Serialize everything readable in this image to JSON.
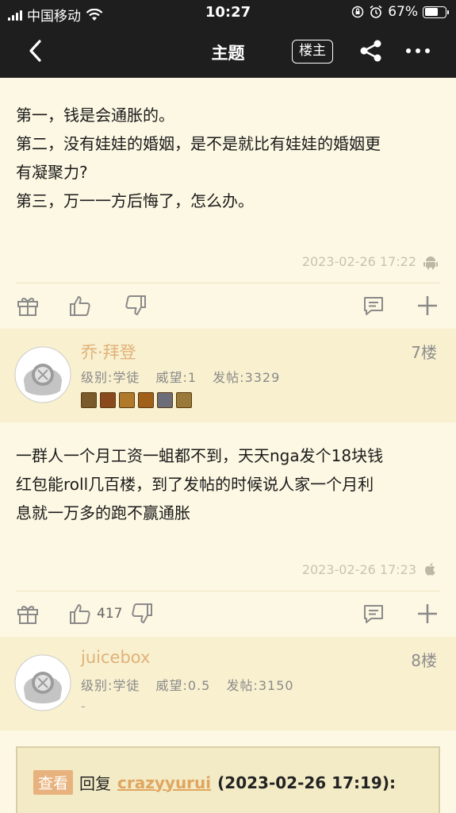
{
  "status_bar": {
    "carrier": "中国移动",
    "time": "10:27",
    "battery": "67%",
    "battery_level": 0.67
  },
  "nav": {
    "title": "主题",
    "louzhu_label": "楼主",
    "back_icon": "chevron-left-icon",
    "share_icon": "share-icon",
    "more_icon": "more-icon"
  },
  "post_prev": {
    "lines": [
      "第一，钱是会通胀的。",
      "第二，没有娃娃的婚姻，是不是就比有娃娃的婚姻更",
      "有凝聚力?",
      "第三，万一一方后悔了，怎么办。"
    ],
    "timestamp": "2023-02-26 17:22",
    "device_icon": "android-icon"
  },
  "reply7": {
    "username": "乔·拜登",
    "floor": "7楼",
    "level": "级别:学徒",
    "prestige": "威望:1",
    "posts": "发帖:3329",
    "badge_colors": [
      "#7a5a2a",
      "#8a4a1e",
      "#b07a2a",
      "#a0601a",
      "#6d6d7a",
      "#9a7a3a"
    ],
    "lines": [
      "一群人一个月工资一蛆都不到，天天nga发个18块钱",
      "红包能roll几百楼，到了发帖的时候说人家一个月利",
      "息就一万多的跑不赢通胀"
    ],
    "timestamp": "2023-02-26 17:23",
    "device_icon": "apple-icon",
    "like_count": "417"
  },
  "reply8": {
    "username": "juicebox",
    "floor": "8楼",
    "level": "级别:学徒",
    "prestige": "威望:0.5",
    "posts": "发帖:3150",
    "extra": "-",
    "quote": {
      "chakan": "查看",
      "reply_word": "回复",
      "user": "crazyyurui",
      "time": "(2023-02-26 17:19):"
    }
  },
  "colors": {
    "background": "#fdf8e3",
    "header_bg": "#1e1e1e",
    "user_header_bg": "#f8f0cf",
    "username": "#e0b27a"
  }
}
